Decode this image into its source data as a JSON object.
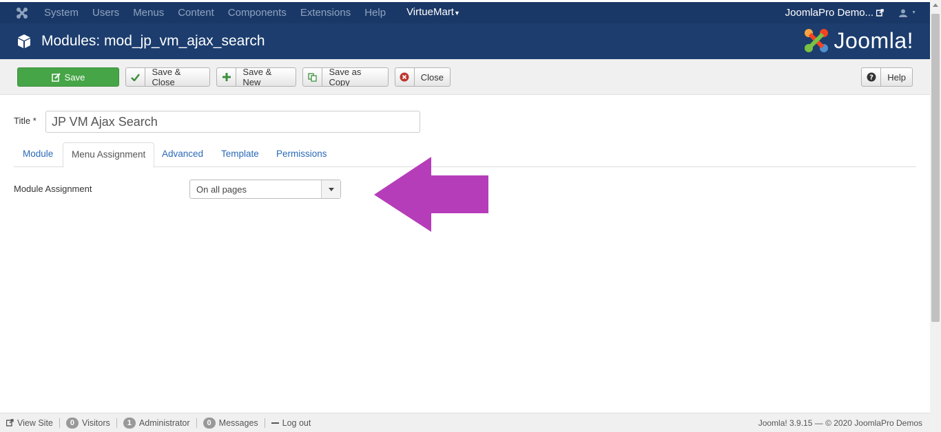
{
  "navbar": {
    "items": [
      {
        "label": "System"
      },
      {
        "label": "Users"
      },
      {
        "label": "Menus"
      },
      {
        "label": "Content"
      },
      {
        "label": "Components"
      },
      {
        "label": "Extensions"
      },
      {
        "label": "Help"
      },
      {
        "label": "VirtueMart"
      }
    ],
    "site_name": "JoomlaPro Demo..."
  },
  "header": {
    "title": "Modules: mod_jp_vm_ajax_search",
    "logo_text": "Joomla!"
  },
  "toolbar": {
    "save": "Save",
    "save_close": "Save & Close",
    "save_new": "Save & New",
    "save_copy": "Save as Copy",
    "close": "Close",
    "help": "Help"
  },
  "form": {
    "title_label": "Title *",
    "title_value": "JP VM Ajax Search",
    "tabs": [
      {
        "label": "Module"
      },
      {
        "label": "Menu Assignment"
      },
      {
        "label": "Advanced"
      },
      {
        "label": "Template"
      },
      {
        "label": "Permissions"
      }
    ],
    "active_tab": "Menu Assignment",
    "module_assignment_label": "Module Assignment",
    "module_assignment_value": "On all pages"
  },
  "statusbar": {
    "view_site": "View Site",
    "visitors_count": "0",
    "visitors": "Visitors",
    "admin_count": "1",
    "admin": "Administrator",
    "messages_count": "0",
    "messages": "Messages",
    "logout": "Log out",
    "version": "Joomla! 3.9.15",
    "copyright": "— © 2020 JoomlaPro Demos"
  },
  "colors": {
    "nav_bg": "#1a3867",
    "header_bg": "#1c3d6e",
    "save_green": "#46a546",
    "arrow_magenta": "#b53db9",
    "link_blue": "#2a69b8"
  }
}
